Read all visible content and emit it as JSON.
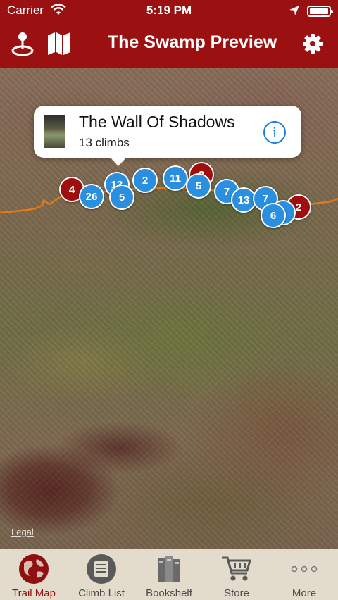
{
  "status_bar": {
    "carrier": "Carrier",
    "time": "5:19 PM"
  },
  "nav": {
    "title": "The Swamp Preview"
  },
  "callout": {
    "title": "The Wall Of Shadows",
    "subtitle": "13 climbs"
  },
  "markers": [
    {
      "label": "4",
      "color": "red"
    },
    {
      "label": "26",
      "color": "blue"
    },
    {
      "label": "13",
      "color": "blue"
    },
    {
      "label": "5",
      "color": "blue"
    },
    {
      "label": "2",
      "color": "blue"
    },
    {
      "label": "11",
      "color": "blue"
    },
    {
      "label": "3",
      "color": "red"
    },
    {
      "label": "5",
      "color": "blue"
    },
    {
      "label": "7",
      "color": "blue"
    },
    {
      "label": "13",
      "color": "blue"
    },
    {
      "label": "7",
      "color": "blue"
    },
    {
      "label": "2",
      "color": "red"
    },
    {
      "label": "",
      "color": "blue"
    },
    {
      "label": "6",
      "color": "blue"
    }
  ],
  "map": {
    "legal": "Legal"
  },
  "tabs": [
    {
      "label": "Trail Map",
      "icon": "globe-icon",
      "active": true
    },
    {
      "label": "Climb List",
      "icon": "list-icon",
      "active": false
    },
    {
      "label": "Bookshelf",
      "icon": "books-icon",
      "active": false
    },
    {
      "label": "Store",
      "icon": "cart-icon",
      "active": false
    },
    {
      "label": "More",
      "icon": "more-icon",
      "active": false
    }
  ],
  "colors": {
    "nav_bar": "#9b1010",
    "marker_blue": "#2b8fe0",
    "marker_red": "#a10e0e",
    "trail": "#e07a1a",
    "tab_active": "#8f1010"
  }
}
